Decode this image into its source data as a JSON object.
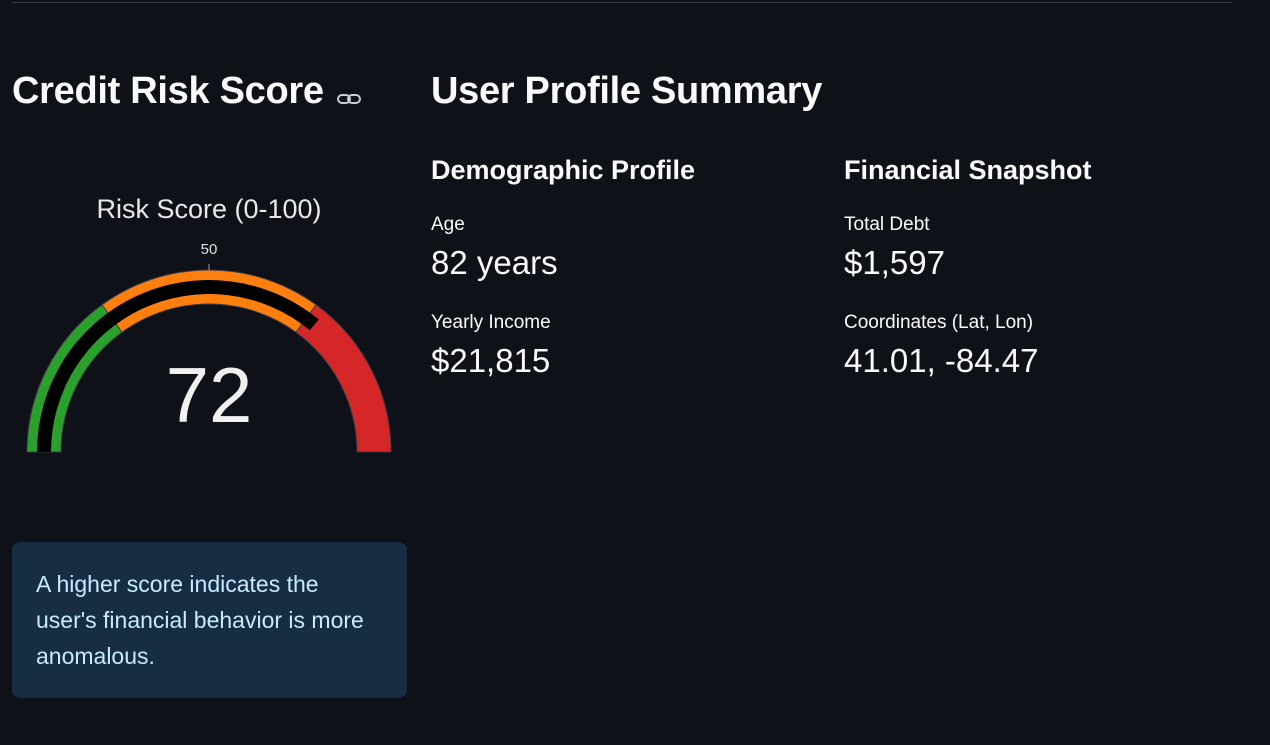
{
  "risk": {
    "heading": "Credit Risk Score",
    "gauge": {
      "title": "Risk Score (0-100)",
      "value": 72,
      "min": 0,
      "max": 100,
      "tick_label": "50",
      "tick_value": 50,
      "bands": [
        {
          "from": 0,
          "to": 30,
          "color": "#2ca02c"
        },
        {
          "from": 30,
          "to": 70,
          "color": "#ff7f0e"
        },
        {
          "from": 70,
          "to": 100,
          "color": "#d62728"
        }
      ],
      "bar_color": "#000000"
    },
    "info_text": "A higher score indicates the user's financial behavior is more anomalous."
  },
  "profile": {
    "title": "User Profile Summary",
    "demographic": {
      "heading": "Demographic Profile",
      "age_label": "Age",
      "age_value": "82 years",
      "income_label": "Yearly Income",
      "income_value": "$21,815"
    },
    "financial": {
      "heading": "Financial Snapshot",
      "debt_label": "Total Debt",
      "debt_value": "$1,597",
      "coords_label": "Coordinates (Lat, Lon)",
      "coords_value": "41.01, -84.47"
    }
  }
}
